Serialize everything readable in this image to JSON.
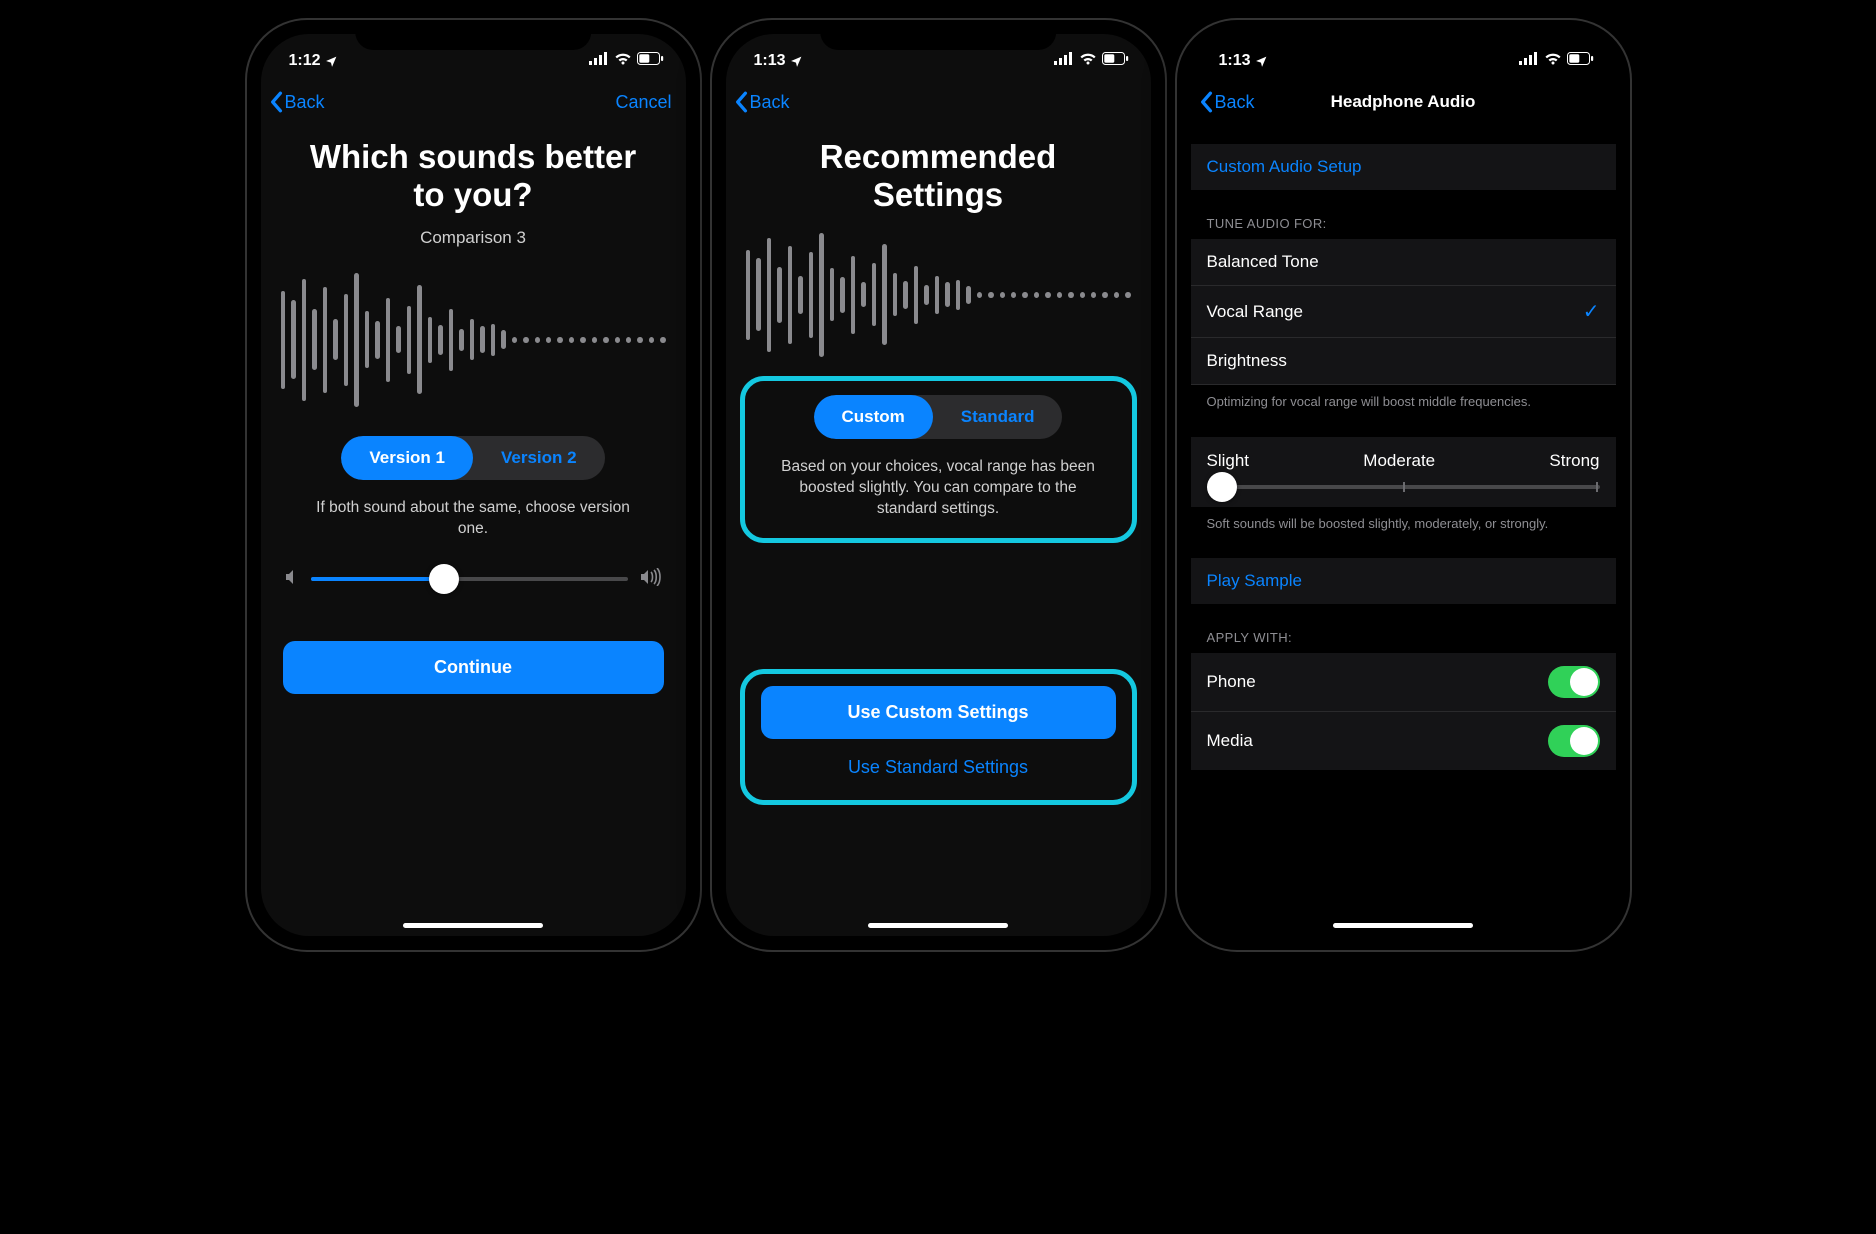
{
  "phone1": {
    "status_time": "1:12",
    "nav_back": "Back",
    "nav_cancel": "Cancel",
    "title": "Which sounds better to you?",
    "subtitle": "Comparison 3",
    "seg1": "Version 1",
    "seg2": "Version 2",
    "help": "If both sound about the same, choose version one.",
    "continue": "Continue"
  },
  "phone2": {
    "status_time": "1:13",
    "nav_back": "Back",
    "title": "Recommended Settings",
    "seg1": "Custom",
    "seg2": "Standard",
    "desc": "Based on your choices, vocal range has been boosted slightly. You can compare to the standard settings.",
    "primary": "Use Custom Settings",
    "secondary": "Use Standard Settings"
  },
  "phone3": {
    "status_time": "1:13",
    "nav_back": "Back",
    "nav_title": "Headphone Audio",
    "custom_setup": "Custom Audio Setup",
    "tune_header": "TUNE AUDIO FOR:",
    "opt1": "Balanced Tone",
    "opt2": "Vocal Range",
    "opt3": "Brightness",
    "tune_footer": "Optimizing for vocal range will boost middle frequencies.",
    "sl_slight": "Slight",
    "sl_mod": "Moderate",
    "sl_strong": "Strong",
    "sl_footer": "Soft sounds will be boosted slightly, moderately, or strongly.",
    "play_sample": "Play Sample",
    "apply_header": "APPLY WITH:",
    "apply_phone": "Phone",
    "apply_media": "Media"
  }
}
